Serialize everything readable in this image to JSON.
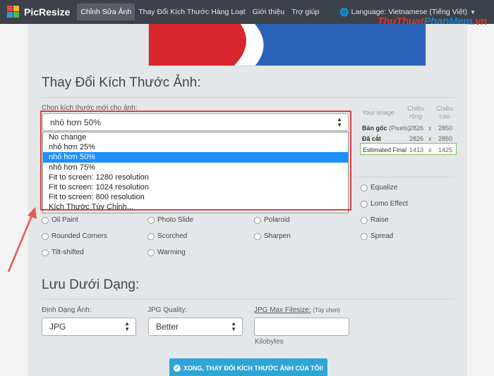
{
  "navbar": {
    "brand": "PicResize",
    "items": [
      "Chỉnh Sửa Ảnh",
      "Thay Đổi Kích Thước Hàng Loạt",
      "Giới thiệu",
      "Trợ giúp"
    ],
    "language": "Language: Vietnamese (Tiếng Việt)"
  },
  "watermark": {
    "part1": "ThuThuat",
    "part2": "PhanMem",
    "part3": ".vn"
  },
  "resize": {
    "title": "Thay Đổi Kích Thước Ảnh:",
    "choose_label": "Chọn kích thước mới cho ảnh:",
    "selected": "nhỏ hơn 50%",
    "options": [
      "No change",
      "nhỏ hơn 25%",
      "nhỏ hơn 50%",
      "nhỏ hơn 75%",
      "Fit to screen: 1280 resolution",
      "Fit to screen: 1024 resolution",
      "Fit to screen: 800 resolution",
      "Kích Thước Tùy Chỉnh..."
    ],
    "selected_index": 2
  },
  "dimensions": {
    "header_label": "Your Image",
    "col_width": "Chiều rộng",
    "col_height": "Chiều cao",
    "rows": [
      {
        "label": "Bản gốc",
        "sub": "(Pixels)",
        "w": "2826",
        "x": "x",
        "h": "2850"
      },
      {
        "label": "Đã cắt",
        "sub": "",
        "w": "2826",
        "x": "x",
        "h": "2850"
      },
      {
        "label": "Estimated Final",
        "sub": "",
        "w": "1413",
        "x": "x",
        "h": "1425"
      }
    ]
  },
  "effects": [
    "Equalize",
    "Lomo Effect",
    "Oil Paint",
    "Photo Slide",
    "Polaroid",
    "Raise",
    "Rounded Corners",
    "Scorched",
    "Sharpen",
    "Spread",
    "Tilt-shifted",
    "Warming"
  ],
  "save": {
    "title": "Lưu Dưới Dạng:",
    "format_label": "Định Dạng Ảnh:",
    "format_value": "JPG",
    "quality_label": "JPG Quality:",
    "quality_value": "Better",
    "maxsize_label": "JPG Max Filesize:",
    "maxsize_hint": "(Tùy chọn)",
    "maxsize_unit": "Kilobytes"
  },
  "submit_label": "XONG, THAY ĐỔI KÍCH THƯỚC ẢNH CỦA TÔI!",
  "colors": {
    "navbar": "#3d4149",
    "accent": "#2ea5d6",
    "selection": "#1e90ff",
    "highlight": "#e03c3c"
  }
}
